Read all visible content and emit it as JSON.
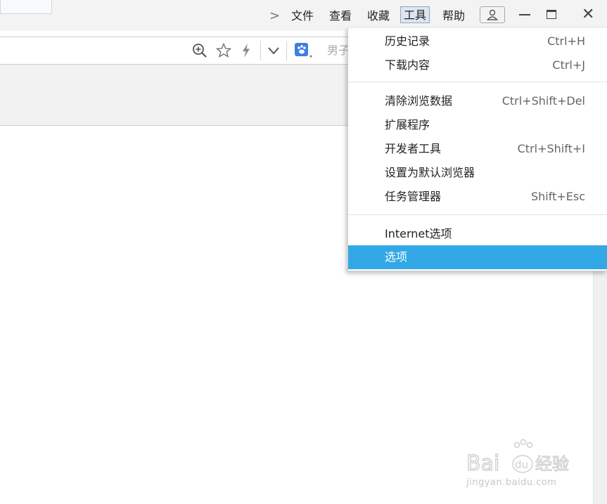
{
  "menubar": {
    "more": ">",
    "items": [
      "文件",
      "查看",
      "收藏",
      "工具",
      "帮助"
    ],
    "active_index": 3
  },
  "window_controls": [
    "user-icon",
    "minimize-icon",
    "maximize-icon",
    "close-icon"
  ],
  "address_bar": {
    "tool_icons": [
      "zoom-in-icon",
      "star-icon",
      "lightning-icon",
      "chevron-down-icon"
    ],
    "search_engine_icon": "baidu-paw-icon",
    "search_text": "男子"
  },
  "tools_menu": {
    "groups": [
      [
        {
          "label": "历史记录",
          "shortcut": "Ctrl+H"
        },
        {
          "label": "下载内容",
          "shortcut": "Ctrl+J"
        }
      ],
      [
        {
          "label": "清除浏览数据",
          "shortcut": "Ctrl+Shift+Del"
        },
        {
          "label": "扩展程序",
          "shortcut": ""
        },
        {
          "label": "开发者工具",
          "shortcut": "Ctrl+Shift+I"
        },
        {
          "label": "设置为默认浏览器",
          "shortcut": ""
        },
        {
          "label": "任务管理器",
          "shortcut": "Shift+Esc"
        }
      ],
      [
        {
          "label": "Internet选项",
          "shortcut": ""
        },
        {
          "label": "选项",
          "shortcut": "",
          "highlighted": true
        }
      ]
    ]
  },
  "watermark": {
    "brand": "Bai",
    "paw": "du",
    "suffix": "经验",
    "domain": "jingyan.baidu.com"
  },
  "colors": {
    "menu_highlight": "#33a8e6",
    "active_menu_bg": "#dde6f0",
    "toolbar_bg": "#f2f2f2"
  }
}
